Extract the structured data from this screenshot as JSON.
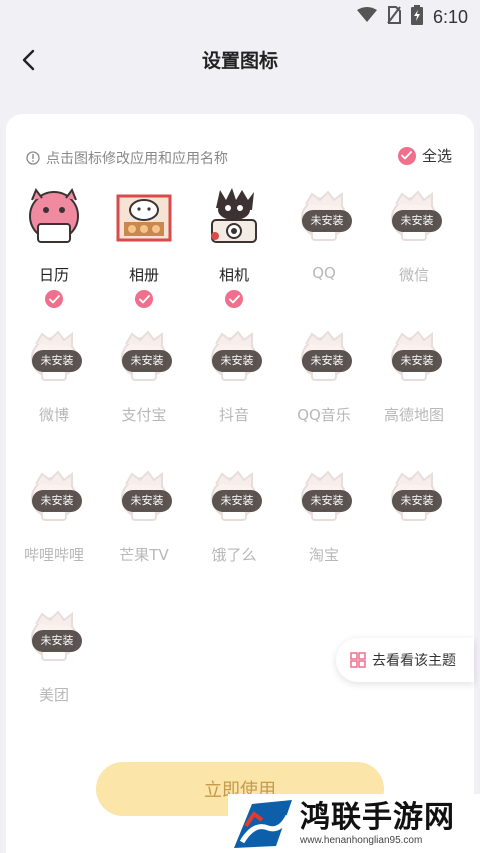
{
  "status_bar": {
    "time": "6:10",
    "icons": [
      "wifi-icon",
      "no-sim-icon",
      "battery-charging-icon"
    ]
  },
  "nav": {
    "title": "设置图标",
    "back_icon": "chevron-left-icon"
  },
  "hint": {
    "text": "点击图标修改应用和应用名称",
    "icon": "info-icon"
  },
  "select_all": {
    "label": "全选",
    "checked": true
  },
  "not_installed_badge": "未安装",
  "apps": [
    {
      "label": "日历",
      "installed": true,
      "selected": true,
      "icon": "calendar-app-icon"
    },
    {
      "label": "相册",
      "installed": true,
      "selected": true,
      "icon": "photo-album-app-icon"
    },
    {
      "label": "相机",
      "installed": true,
      "selected": true,
      "icon": "camera-app-icon"
    },
    {
      "label": "QQ",
      "installed": false,
      "icon": "qq-app-icon"
    },
    {
      "label": "微信",
      "installed": false,
      "icon": "wechat-app-icon"
    },
    {
      "label": "微博",
      "installed": false,
      "icon": "weibo-app-icon"
    },
    {
      "label": "支付宝",
      "installed": false,
      "icon": "alipay-app-icon"
    },
    {
      "label": "抖音",
      "installed": false,
      "icon": "douyin-app-icon"
    },
    {
      "label": "QQ音乐",
      "installed": false,
      "icon": "qq-music-app-icon"
    },
    {
      "label": "高德地图",
      "installed": false,
      "icon": "amap-app-icon"
    },
    {
      "label": "哔哩哔哩",
      "installed": false,
      "icon": "bilibili-app-icon"
    },
    {
      "label": "芒果TV",
      "installed": false,
      "icon": "mango-tv-app-icon"
    },
    {
      "label": "饿了么",
      "installed": false,
      "icon": "eleme-app-icon"
    },
    {
      "label": "淘宝",
      "installed": false,
      "icon": "taobao-app-icon"
    },
    {
      "label": "",
      "installed": false,
      "icon": "app-icon"
    },
    {
      "label": "美团",
      "installed": false,
      "icon": "meituan-app-icon"
    }
  ],
  "float_button": {
    "label": "去看看该主题",
    "icon": "grid-icon"
  },
  "apply_button": {
    "label": "立即使用"
  },
  "watermark": {
    "text": "鸿联手游网",
    "url": "www.henanhonglian95.com"
  },
  "colors": {
    "accent_pink": "#ef6f8c",
    "apply_bg": "#fbe5a9",
    "apply_text": "#c69a4a",
    "badge_bg": "#463e3a"
  }
}
